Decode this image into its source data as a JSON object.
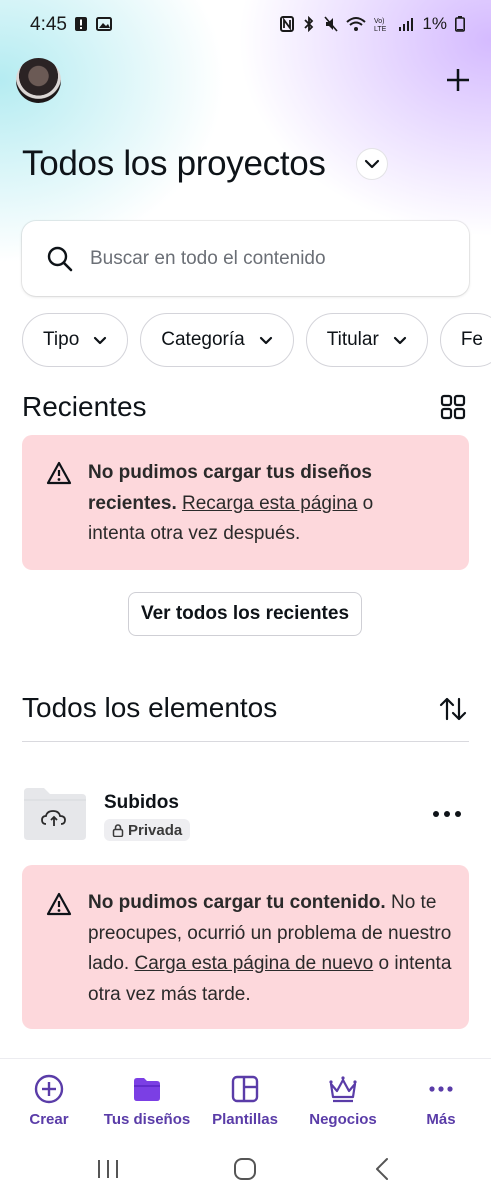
{
  "status_bar": {
    "time": "4:45",
    "battery": "1%"
  },
  "header": {
    "page_title": "Todos los proyectos"
  },
  "search": {
    "placeholder": "Buscar en todo el contenido"
  },
  "filters": [
    "Tipo",
    "Categoría",
    "Titular",
    "Fe"
  ],
  "recent": {
    "title": "Recientes",
    "error_bold": "No pudimos cargar tus diseños recientes.",
    "error_link": "Recarga esta página",
    "error_tail": "o intenta otra vez después.",
    "view_all_label": "Ver todos los recientes"
  },
  "all_items": {
    "title": "Todos los elementos",
    "folder": {
      "name": "Subidos",
      "privacy": "Privada"
    },
    "error_bold": "No pudimos cargar tu contenido.",
    "error_text": "No te preocupes, ocurrió un problema de nuestro lado.",
    "error_link": "Carga esta página de nuevo",
    "error_tail": "o intenta otra vez más tarde."
  },
  "bottom_nav": [
    {
      "label": "Crear",
      "icon": "plus-circle-icon"
    },
    {
      "label": "Tus diseños",
      "icon": "folder-icon"
    },
    {
      "label": "Plantillas",
      "icon": "templates-icon"
    },
    {
      "label": "Negocios",
      "icon": "crown-icon"
    },
    {
      "label": "Más",
      "icon": "more-dots-icon"
    }
  ],
  "colors": {
    "accent": "#5a3ca8",
    "alert_bg": "#fdd8dc"
  }
}
